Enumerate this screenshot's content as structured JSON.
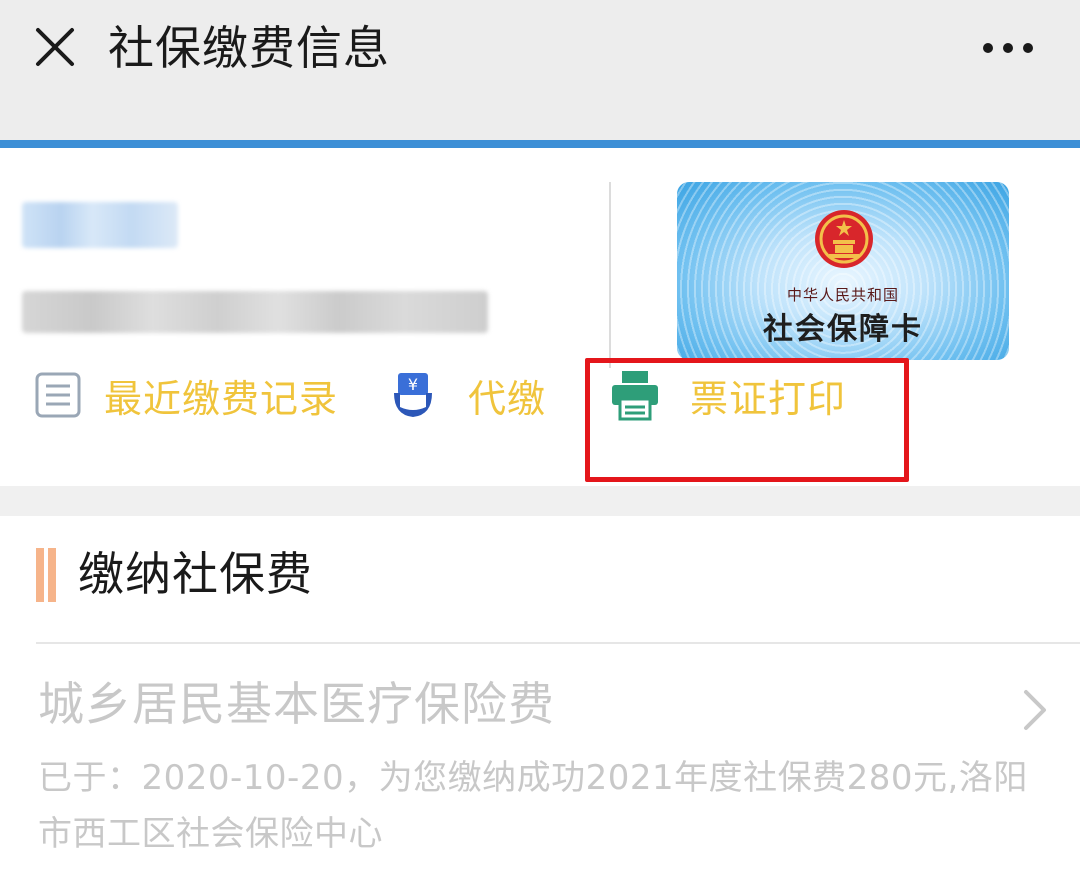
{
  "header": {
    "title": "社保缴费信息",
    "close_icon": "close-icon",
    "more_icon": "more-dots-icon"
  },
  "profile": {
    "card": {
      "country": "中华人民共和国",
      "name": "社会保障卡",
      "emblem_icon": "national-emblem-icon"
    },
    "actions": [
      {
        "label": "最近缴费记录",
        "icon": "document-list-icon"
      },
      {
        "label": "代缴",
        "icon": "yen-hand-icon"
      },
      {
        "label": "票证打印",
        "icon": "printer-icon"
      }
    ]
  },
  "section": {
    "title": "缴纳社保费",
    "item": {
      "title": "城乡居民基本医疗保险费",
      "description": "已于：2020-10-20，为您缴纳成功2021年度社保费280元,洛阳市西工区社会保险中心"
    }
  },
  "colors": {
    "accent_blue": "#3d8fd6",
    "action_label": "#f0c43c",
    "highlight_red": "#e4161b",
    "section_bar": "#f6b48a",
    "muted_text": "#c8c8c8"
  }
}
